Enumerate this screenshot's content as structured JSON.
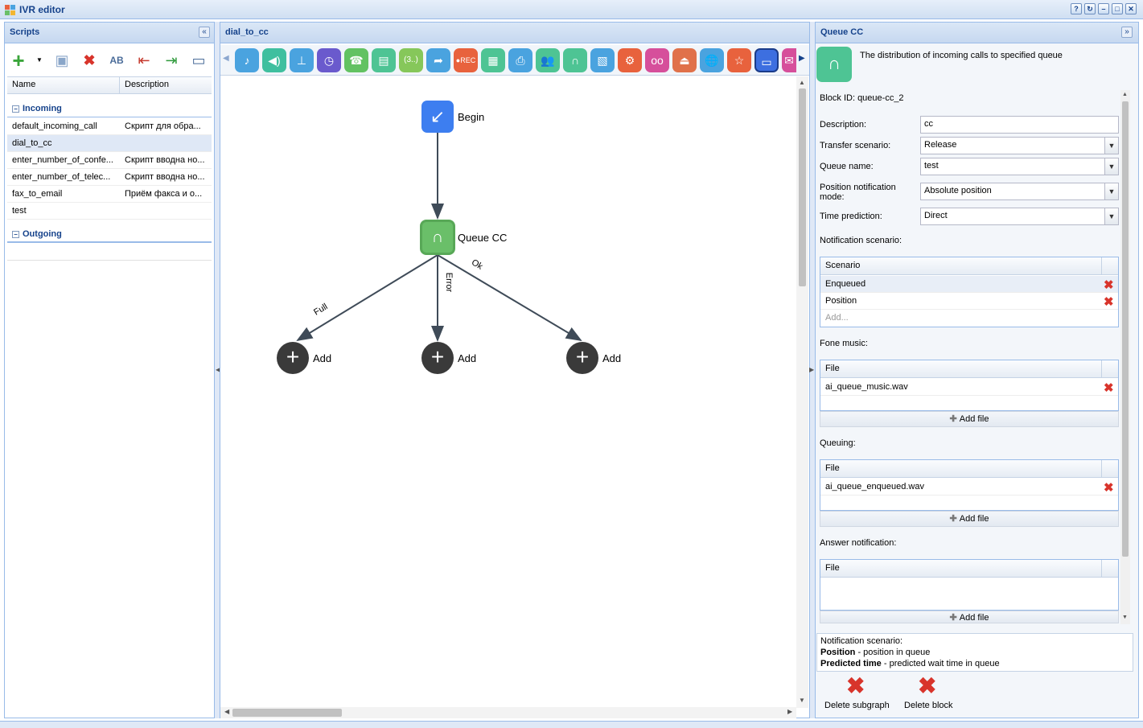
{
  "app": {
    "title": "IVR editor"
  },
  "left": {
    "title": "Scripts",
    "columns": [
      "Name",
      "Description"
    ],
    "groups": [
      {
        "label": "Incoming",
        "rows": [
          {
            "name": "default_incoming_call",
            "desc": "Скрипт для обра..."
          },
          {
            "name": "dial_to_cc",
            "desc": ""
          },
          {
            "name": "enter_number_of_confe...",
            "desc": "Скрипт вводна но..."
          },
          {
            "name": "enter_number_of_telec...",
            "desc": "Скрипт вводна но..."
          },
          {
            "name": "fax_to_email",
            "desc": "Приём факса и о..."
          },
          {
            "name": "test",
            "desc": ""
          }
        ]
      },
      {
        "label": "Outgoing",
        "rows": []
      }
    ]
  },
  "canvas": {
    "title": "dial_to_cc",
    "begin_label": "Begin",
    "queue_label": "Queue CC",
    "edges": {
      "full": "Full",
      "error": "Error",
      "ok": "Ok"
    },
    "add_label": "Add"
  },
  "right": {
    "title": "Queue CC",
    "description_text": "The distribution of incoming calls to specified queue",
    "block_id": "Block ID: queue-cc_2",
    "fields": {
      "description": {
        "label": "Description:",
        "value": "cc"
      },
      "transfer": {
        "label": "Transfer scenario:",
        "value": "Release"
      },
      "queue_name": {
        "label": "Queue name:",
        "value": "test"
      },
      "position_mode": {
        "label": "Position notification mode:",
        "value": "Absolute position"
      },
      "time_prediction": {
        "label": "Time prediction:",
        "value": "Direct"
      }
    },
    "notification": {
      "label": "Notification scenario:",
      "column": "Scenario",
      "rows": [
        "Enqueued",
        "Position"
      ],
      "add_placeholder": "Add..."
    },
    "fone_music": {
      "label": "Fone music:",
      "column": "File",
      "rows": [
        "ai_queue_music.wav"
      ],
      "add": "Add file"
    },
    "queuing": {
      "label": "Queuing:",
      "column": "File",
      "rows": [
        "ai_queue_enqueued.wav"
      ],
      "add": "Add file"
    },
    "answer": {
      "label": "Answer notification:",
      "column": "File",
      "add": "Add file"
    },
    "help": {
      "title": "Notification scenario:",
      "l1b": "Position",
      "l1": " - position in queue",
      "l2b": "Predicted time",
      "l2": " - predicted wait time in queue"
    },
    "actions": {
      "delete_subgraph": "Delete subgraph",
      "delete_block": "Delete block"
    }
  },
  "colors": {
    "accent": "#15428b",
    "border": "#99bbe8",
    "begin": "#3d7ef0",
    "queue": "#6abf69",
    "add": "#3a3a3a"
  }
}
